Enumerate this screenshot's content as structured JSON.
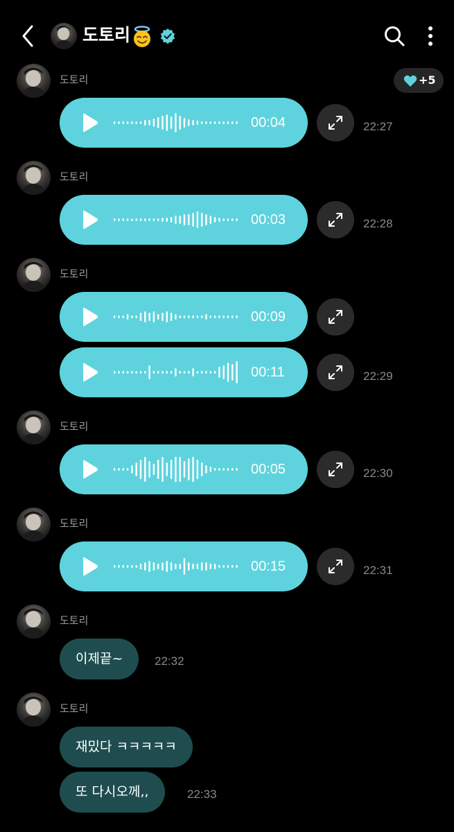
{
  "header": {
    "title": "도토리",
    "emoji": "😇",
    "back_icon": "chevron-left-icon",
    "search_icon": "search-icon",
    "menu_icon": "more-vertical-icon",
    "verified_icon": "verified-badge-icon"
  },
  "reaction": {
    "icon": "heart-icon",
    "count": "+5",
    "color": "#5ed3dd"
  },
  "colors": {
    "voice_bubble": "#5ed3dd",
    "text_bubble": "#1f4d4f",
    "background": "#000000"
  },
  "messages": [
    {
      "sender": "도토리",
      "voice": [
        {
          "duration": "00:04"
        }
      ],
      "time": "22:27"
    },
    {
      "sender": "도토리",
      "voice": [
        {
          "duration": "00:03"
        }
      ],
      "time": "22:28"
    },
    {
      "sender": "도토리",
      "voice": [
        {
          "duration": "00:09"
        },
        {
          "duration": "00:11"
        }
      ],
      "time": "22:29"
    },
    {
      "sender": "도토리",
      "voice": [
        {
          "duration": "00:05"
        }
      ],
      "time": "22:30"
    },
    {
      "sender": "도토리",
      "voice": [
        {
          "duration": "00:15"
        }
      ],
      "time": "22:31"
    },
    {
      "sender": "도토리",
      "texts": [
        "이제끝~"
      ],
      "time": "22:32"
    },
    {
      "sender": "도토리",
      "texts": [
        "재밌다 ㅋㅋㅋㅋㅋ",
        "또 다시오께,,"
      ],
      "time": "22:33"
    }
  ]
}
